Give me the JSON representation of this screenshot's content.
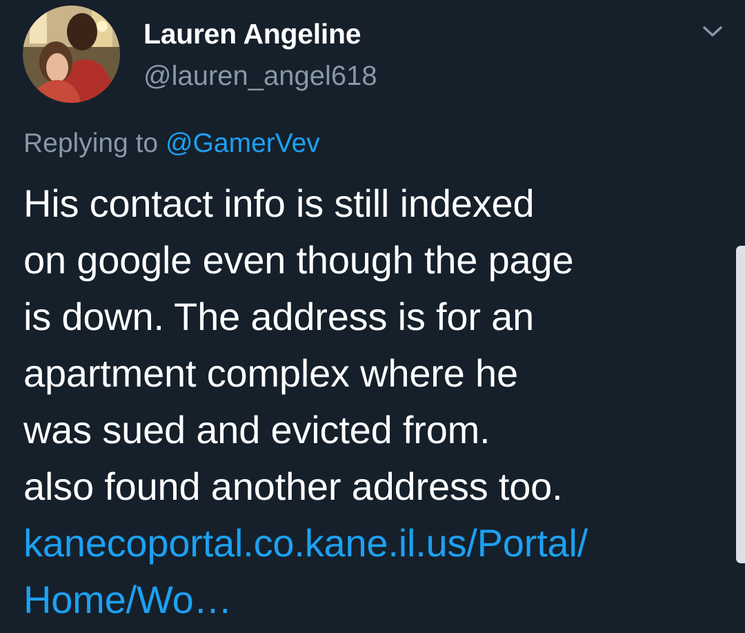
{
  "author": {
    "display_name": "Lauren Angeline",
    "handle": "@lauren_angel618",
    "avatar_icon": "profile-photo"
  },
  "reply": {
    "prefix": "Replying to",
    "mention": "@GamerVev"
  },
  "body": {
    "lines": [
      "His contact info is still indexed",
      "on google even though the page",
      "is down. The address is for an",
      "apartment complex where he",
      "was sued and evicted from.",
      "also found another address too."
    ],
    "link_lines": [
      "kanecoportal.co.kane.il.us/Portal/",
      "Home/Wo…"
    ]
  },
  "icons": {
    "menu": "chevron-down-icon"
  },
  "colors": {
    "background": "#15202b",
    "text": "#ffffff",
    "secondary_text": "#8899a6",
    "link": "#1da1f2"
  }
}
